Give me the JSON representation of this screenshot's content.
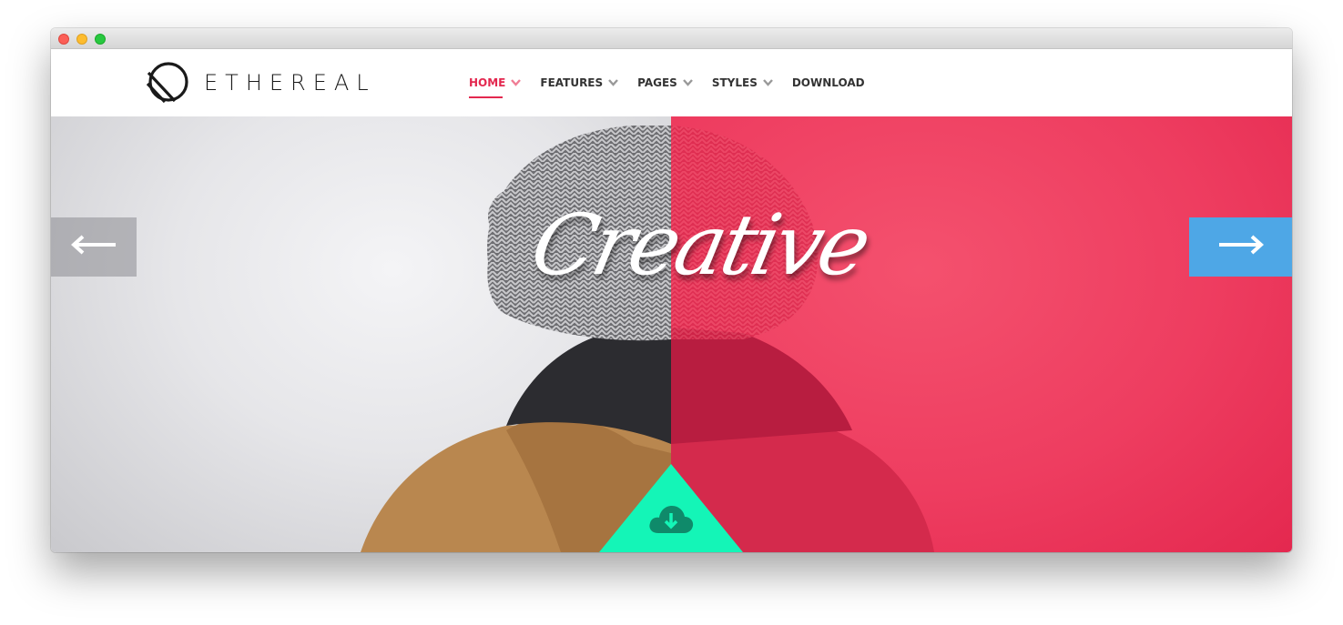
{
  "window": {
    "controls": [
      "close",
      "minimize",
      "zoom"
    ]
  },
  "brand": {
    "name": "ETHEREAL",
    "icon": "ethereal-logo-icon"
  },
  "nav": {
    "items": [
      {
        "label": "HOME",
        "has_dropdown": true,
        "active": true
      },
      {
        "label": "FEATURES",
        "has_dropdown": true,
        "active": false
      },
      {
        "label": "PAGES",
        "has_dropdown": true,
        "active": false
      },
      {
        "label": "STYLES",
        "has_dropdown": true,
        "active": false
      },
      {
        "label": "DOWNLOAD",
        "has_dropdown": false,
        "active": false
      }
    ]
  },
  "hero": {
    "headline": "Creative",
    "prev_icon": "arrow-left-icon",
    "next_icon": "arrow-right-icon",
    "download_icon": "cloud-download-icon"
  },
  "colors": {
    "accent": "#e3284f",
    "overlay": "#ee3d60",
    "next_button": "#4ea7e6",
    "download_triangle": "#14f5b7",
    "download_icon": "#0f8a6a"
  }
}
